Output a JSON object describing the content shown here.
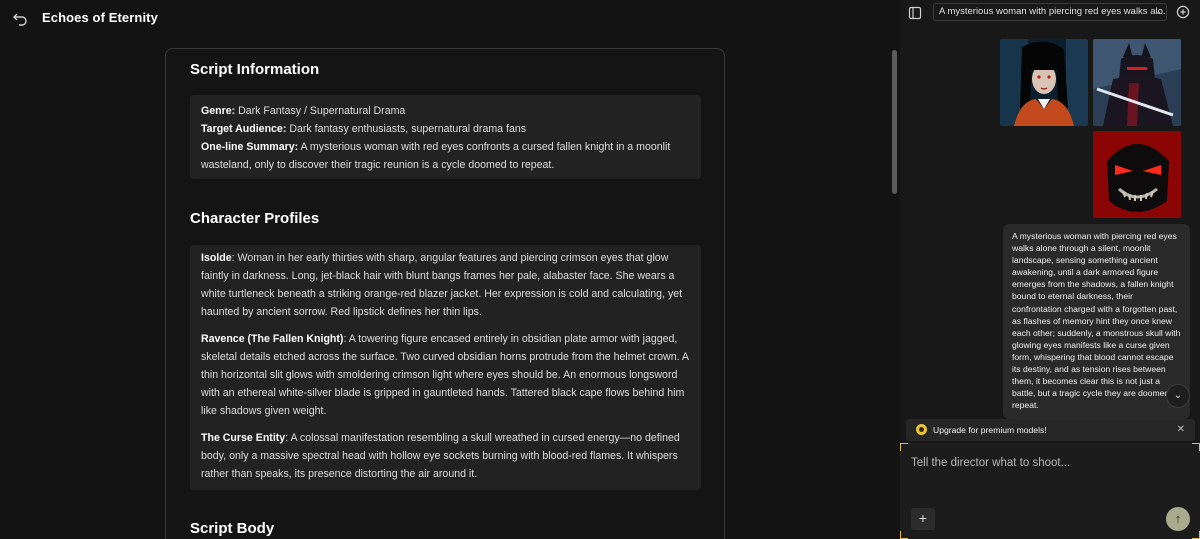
{
  "header": {
    "title": "Echoes of Eternity",
    "back_icon": "undo-arrow-icon"
  },
  "script_info": {
    "title": "Script Information",
    "genre_label": "Genre:",
    "genre_value": "Dark Fantasy / Supernatural Drama",
    "audience_label": "Target Audience:",
    "audience_value": "Dark fantasy enthusiasts, supernatural drama fans",
    "summary_label": "One-line Summary:",
    "summary_value": "A mysterious woman with red eyes confronts a cursed fallen knight in a moonlit wasteland, only to discover their tragic reunion is a cycle doomed to repeat."
  },
  "characters": {
    "title": "Character Profiles",
    "items": [
      {
        "name": "Isolde",
        "description": "Woman in her early thirties with sharp, angular features and piercing crimson eyes that glow faintly in darkness. Long, jet-black hair with blunt bangs frames her pale, alabaster face. She wears a white turtleneck beneath a striking orange-red blazer jacket. Her expression is cold and calculating, yet haunted by ancient sorrow. Red lipstick defines her thin lips."
      },
      {
        "name": "Ravence (The Fallen Knight)",
        "description": "A towering figure encased entirely in obsidian plate armor with jagged, skeletal details etched across the surface. Two curved obsidian horns protrude from the helmet crown. A thin horizontal slit glows with smoldering crimson light where eyes should be. An enormous longsword with an ethereal white-silver blade is gripped in gauntleted hands. Tattered black cape flows behind him like shadows given weight."
      },
      {
        "name": "The Curse Entity",
        "description": "A colossal manifestation resembling a skull wreathed in cursed energy—no defined body, only a massive spectral head with hollow eye sockets burning with blood-red flames. It whispers rather than speaks, its presence distorting the air around it."
      }
    ]
  },
  "script_body": {
    "title": "Script Body"
  },
  "side_panel": {
    "thread_title": "A mysterious woman with piercing red eyes walks alo...",
    "prompt_text": "A mysterious woman with piercing red eyes walks alone through a silent, moonlit landscape, sensing something ancient awakening, until a dark armored figure emerges from the shadows, a fallen knight bound to eternal darkness, their confrontation charged with a forgotten past, as flashes of memory hint they once knew each other; suddenly, a monstrous skull with glowing eyes manifests like a curse given form, whispering that blood cannot escape its destiny, and as tension rises between them, it becomes clear this is not just a battle, but a tragic cycle they are doomed to repeat.",
    "upgrade_text": "Upgrade for premium models!",
    "composer_placeholder": "Tell the director what to shoot...",
    "add_label": "+",
    "accent": "#e8b84a",
    "send_color": "#a8ab8c"
  }
}
